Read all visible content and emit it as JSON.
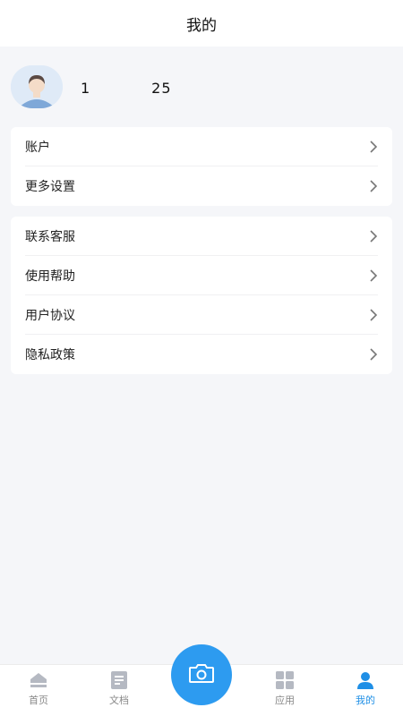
{
  "header": {
    "title": "我的"
  },
  "profile": {
    "username": "1　　　　25"
  },
  "group1": [
    {
      "label": "账户"
    },
    {
      "label": "更多设置"
    }
  ],
  "group2": [
    {
      "label": "联系客服"
    },
    {
      "label": "使用帮助"
    },
    {
      "label": "用户协议"
    },
    {
      "label": "隐私政策"
    }
  ],
  "tabbar": {
    "home": "首页",
    "docs": "文档",
    "apps": "应用",
    "mine": "我的"
  },
  "colors": {
    "accent": "#2d9bf0",
    "active_tab": "#1f8fe6"
  }
}
